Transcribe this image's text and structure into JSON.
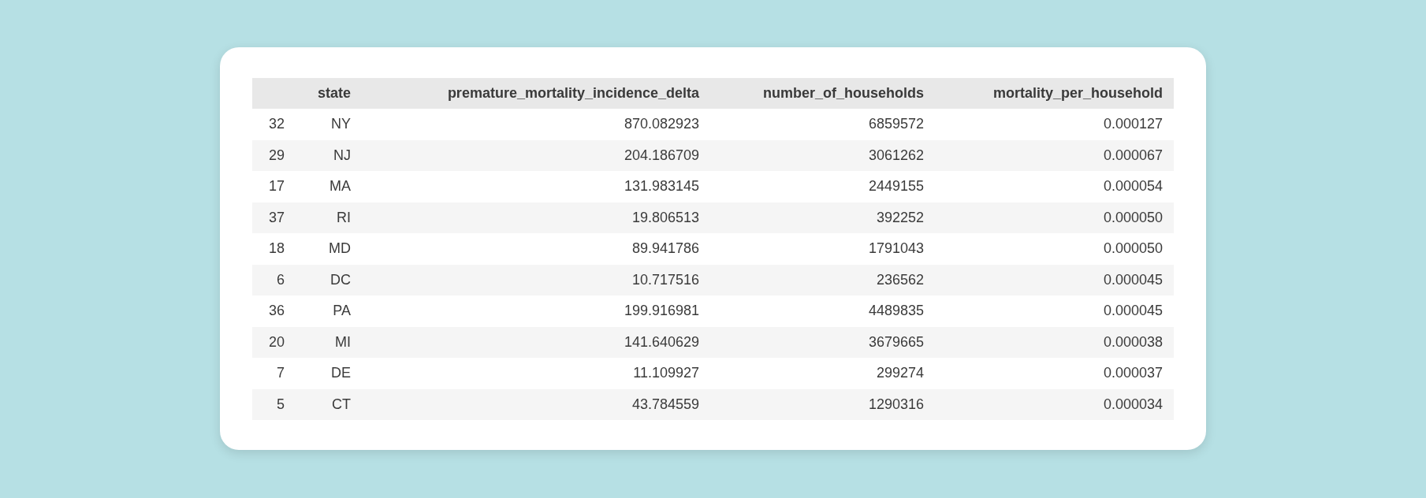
{
  "table": {
    "columns": [
      "",
      "state",
      "premature_mortality_incidence_delta",
      "number_of_households",
      "mortality_per_household"
    ],
    "rows": [
      [
        "32",
        "NY",
        "870.082923",
        "6859572",
        "0.000127"
      ],
      [
        "29",
        "NJ",
        "204.186709",
        "3061262",
        "0.000067"
      ],
      [
        "17",
        "MA",
        "131.983145",
        "2449155",
        "0.000054"
      ],
      [
        "37",
        "RI",
        "19.806513",
        "392252",
        "0.000050"
      ],
      [
        "18",
        "MD",
        "89.941786",
        "1791043",
        "0.000050"
      ],
      [
        "6",
        "DC",
        "10.717516",
        "236562",
        "0.000045"
      ],
      [
        "36",
        "PA",
        "199.916981",
        "4489835",
        "0.000045"
      ],
      [
        "20",
        "MI",
        "141.640629",
        "3679665",
        "0.000038"
      ],
      [
        "7",
        "DE",
        "11.109927",
        "299274",
        "0.000037"
      ],
      [
        "5",
        "CT",
        "43.784559",
        "1290316",
        "0.000034"
      ]
    ]
  }
}
